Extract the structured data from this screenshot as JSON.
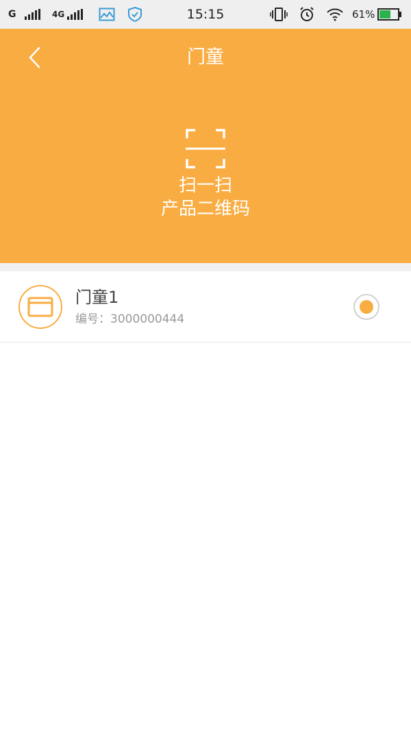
{
  "status_bar": {
    "carrier1": "G",
    "carrier2": "4G",
    "time": "15:15",
    "battery_percent": "61%",
    "icons": [
      "signal-icon",
      "signal-icon",
      "photo-icon",
      "shield-icon",
      "vibrate-icon",
      "alarm-icon",
      "wifi-icon",
      "battery-icon"
    ],
    "battery_level": 0.61
  },
  "header": {
    "title": "门童",
    "back_icon": "chevron-left-icon",
    "scan": {
      "icon": "scan-icon",
      "line1": "扫一扫",
      "line2": "产品二维码"
    }
  },
  "devices": [
    {
      "name": "门童1",
      "id_label": "编号：",
      "id_value": "3000000444",
      "icon": "device-screen-icon",
      "selected": true
    }
  ],
  "colors": {
    "accent": "#f9ac41",
    "status_bar_bg": "#efefef",
    "divider": "#f0f0f0",
    "subtext": "#999999"
  }
}
